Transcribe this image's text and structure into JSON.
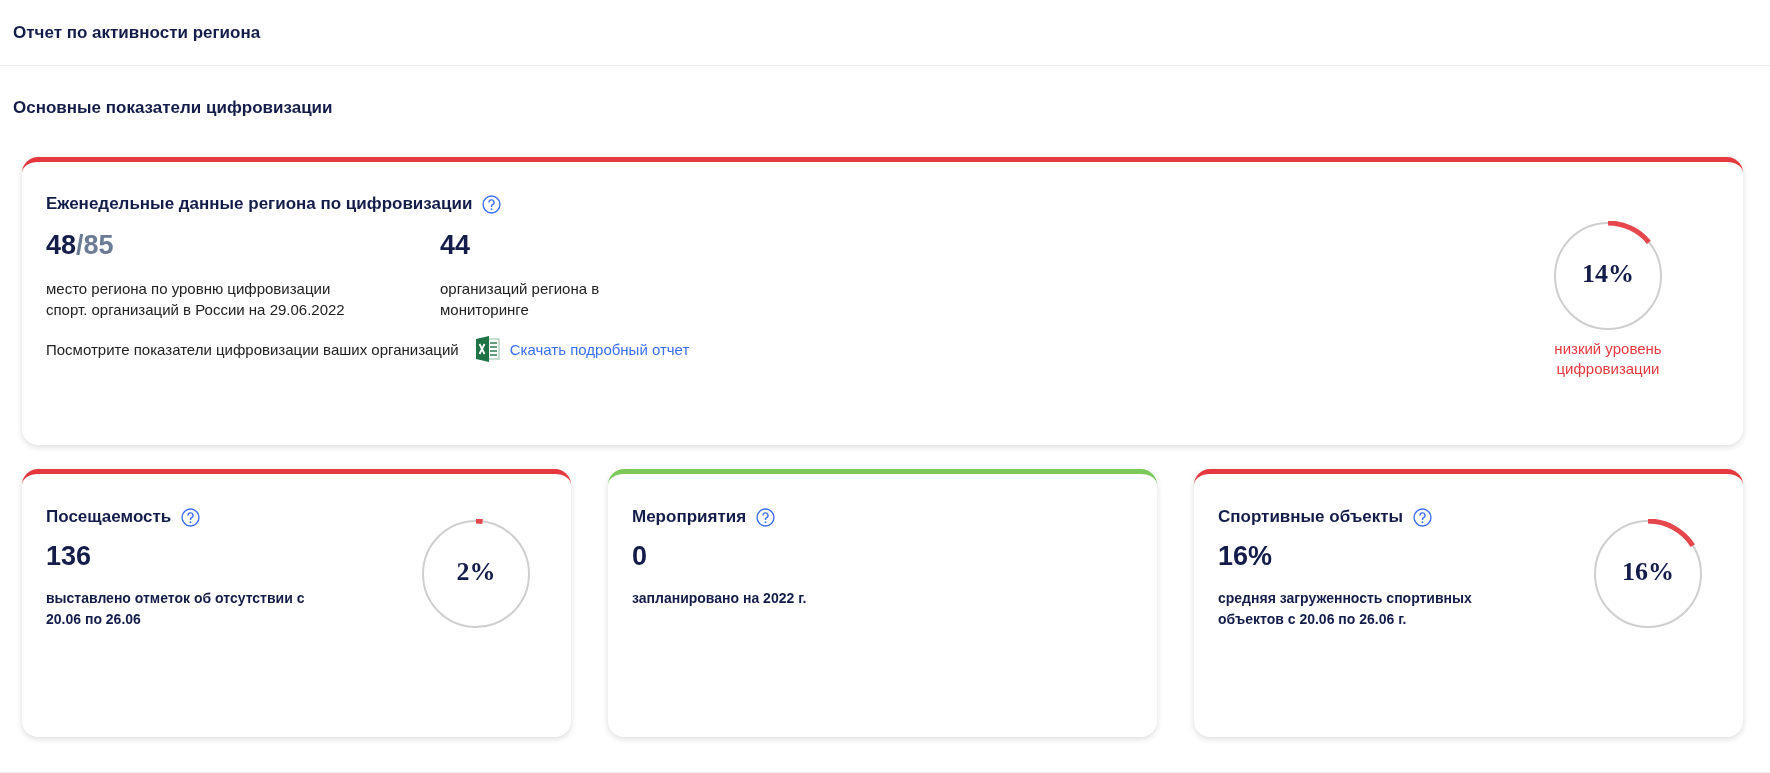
{
  "header": {
    "title": "Отчет по активности региона"
  },
  "section": {
    "title": "Основные показатели цифровизации"
  },
  "main_card": {
    "color": "#e5393f",
    "title": "Еженедельные данные региона по цифровизации",
    "rank": {
      "value": "48",
      "total": "/85",
      "caption": "место региона по уровню цифровизации спорт. организаций в России на 29.06.2022"
    },
    "orgs": {
      "value": "44",
      "caption": "организаций региона в мониторинге"
    },
    "note": "Посмотрите показатели цифровизации ваших организаций",
    "link": "Скачать подробный отчет",
    "ring": {
      "level": 0.14,
      "label": "14%",
      "caption": "низкий уровень цифровизации"
    }
  },
  "cards": [
    {
      "color": "#e5393f",
      "title": "Посещаемость",
      "value": "136",
      "caption": "выставлено отметок об отсутствии с 20.06 по 26.06",
      "ring": {
        "level": 0.02,
        "label": "2%"
      }
    },
    {
      "color": "#7cc95a",
      "title": "Мероприятия",
      "value": "0",
      "caption": "запланировано на 2022 г."
    },
    {
      "color": "#e5393f",
      "title": "Спортивные объекты",
      "value": "16%",
      "caption": "средняя загруженность спортивных объектов с 20.06 по 26.06 г.",
      "ring": {
        "level": 0.16,
        "label": "16%"
      }
    }
  ]
}
